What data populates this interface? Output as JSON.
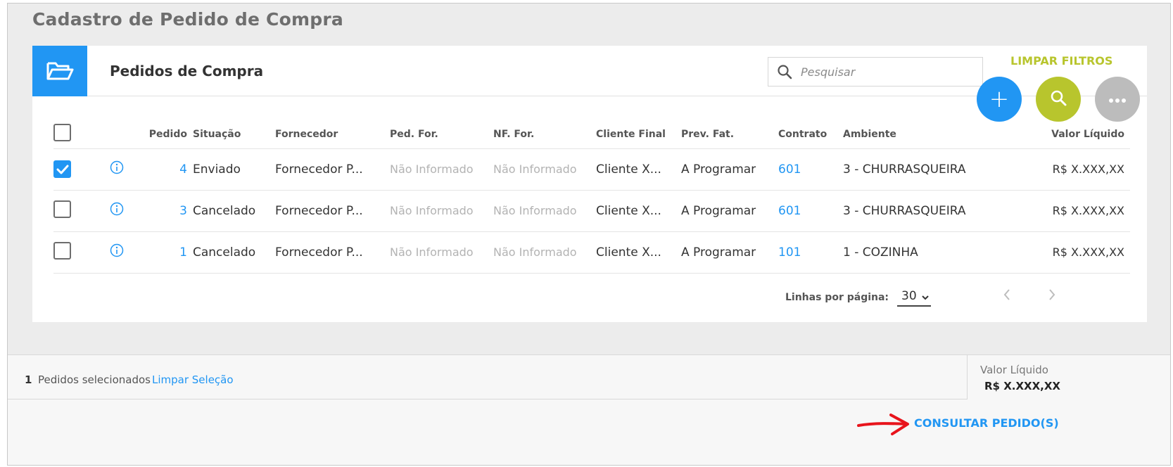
{
  "page": {
    "title": "Cadastro de Pedido de Compra"
  },
  "card": {
    "title": "Pedidos de Compra",
    "folder_icon": "folder-open-icon"
  },
  "search": {
    "placeholder": "Pesquisar"
  },
  "filters": {
    "clear_label": "LIMPAR FILTROS"
  },
  "fabs": {
    "add": "+",
    "search_icon": "search-icon",
    "more_icon": "more-icon"
  },
  "table": {
    "columns": [
      "Pedido",
      "Situação",
      "Fornecedor",
      "Ped. For.",
      "NF. For.",
      "Cliente Final",
      "Prev. Fat.",
      "Contrato",
      "Ambiente",
      "Valor Líquido"
    ],
    "rows": [
      {
        "checked": true,
        "pedido": "4",
        "situacao": "Enviado",
        "fornecedor": "Fornecedor P...",
        "ped_for": "Não Informado",
        "nf_for": "Não Informado",
        "cliente_final": "Cliente X...",
        "prev_fat": "A Programar",
        "contrato": "601",
        "ambiente": "3 - CHURRASQUEIRA",
        "valor_liquido": "R$ X.XXX,XX"
      },
      {
        "checked": false,
        "pedido": "3",
        "situacao": "Cancelado",
        "fornecedor": "Fornecedor P...",
        "ped_for": "Não Informado",
        "nf_for": "Não Informado",
        "cliente_final": "Cliente X...",
        "prev_fat": "A Programar",
        "contrato": "601",
        "ambiente": "3 - CHURRASQUEIRA",
        "valor_liquido": "R$ X.XXX,XX"
      },
      {
        "checked": false,
        "pedido": "1",
        "situacao": "Cancelado",
        "fornecedor": "Fornecedor P...",
        "ped_for": "Não Informado",
        "nf_for": "Não Informado",
        "cliente_final": "Cliente X...",
        "prev_fat": "A Programar",
        "contrato": "101",
        "ambiente": "1 - COZINHA",
        "valor_liquido": "R$ X.XXX,XX"
      }
    ]
  },
  "pagination": {
    "rows_label": "Linhas por página:",
    "rows_value": "30",
    "options": [
      "30"
    ]
  },
  "selection": {
    "count": "1",
    "text": "Pedidos selecionados",
    "clear_label": "Limpar Seleção"
  },
  "total": {
    "label": "Valor Líquido",
    "value": "R$ X.XXX,XX"
  },
  "action": {
    "label": "CONSULTAR PEDIDO(S)"
  },
  "colors": {
    "primary": "#2196f3",
    "lime": "#b8c52d",
    "gray": "#bcbcbc",
    "arrow": "#e8141c"
  }
}
